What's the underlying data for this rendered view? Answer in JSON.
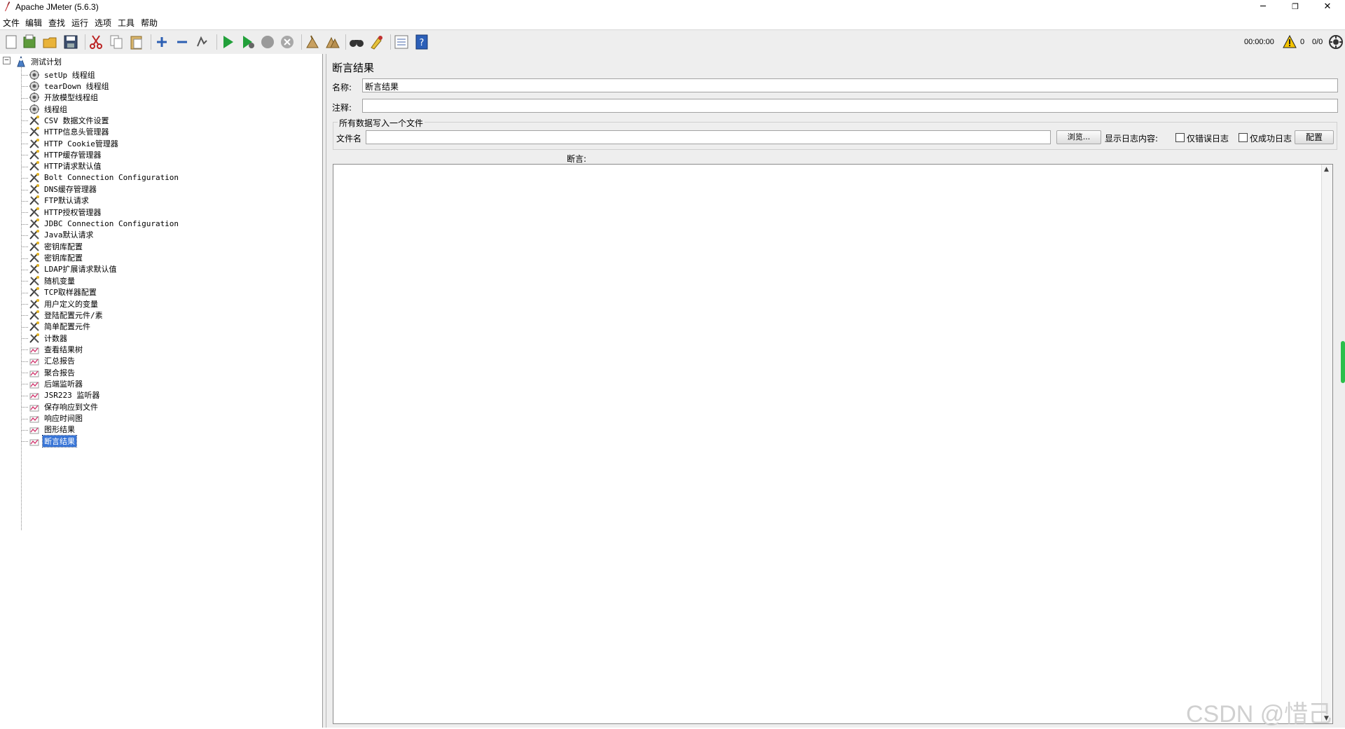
{
  "window": {
    "title": "Apache JMeter (5.6.3)",
    "controls": {
      "minimize": "─",
      "restore": "❐",
      "close": "✕"
    }
  },
  "menu": [
    "文件",
    "编辑",
    "查找",
    "运行",
    "选项",
    "工具",
    "帮助"
  ],
  "toolbar": {
    "icons": [
      "new-icon",
      "templates-icon",
      "open-icon",
      "save-icon",
      "cut-icon",
      "copy-icon",
      "paste-icon",
      "expand-icon",
      "collapse-icon",
      "toggle-icon",
      "start-icon",
      "start-no-pause-icon",
      "stop-icon",
      "shutdown-icon",
      "clear-icon",
      "clear-all-icon",
      "search-icon",
      "reset-search-icon",
      "function-helper-icon",
      "help-icon"
    ],
    "timer": "00:00:00",
    "warning_count": "0",
    "threads": "0/0"
  },
  "tree": {
    "root": "测试计划",
    "items": [
      {
        "label": "setUp 线程组",
        "icon": "thread-group-icon"
      },
      {
        "label": "tearDown 线程组",
        "icon": "thread-group-icon"
      },
      {
        "label": "开放模型线程组",
        "icon": "thread-group-icon"
      },
      {
        "label": "线程组",
        "icon": "thread-group-icon"
      },
      {
        "label": "CSV 数据文件设置",
        "icon": "config-element-icon"
      },
      {
        "label": "HTTP信息头管理器",
        "icon": "config-element-icon"
      },
      {
        "label": "HTTP Cookie管理器",
        "icon": "config-element-icon"
      },
      {
        "label": "HTTP缓存管理器",
        "icon": "config-element-icon"
      },
      {
        "label": "HTTP请求默认值",
        "icon": "config-element-icon"
      },
      {
        "label": "Bolt Connection Configuration",
        "icon": "config-element-icon"
      },
      {
        "label": "DNS缓存管理器",
        "icon": "config-element-icon"
      },
      {
        "label": "FTP默认请求",
        "icon": "config-element-icon"
      },
      {
        "label": "HTTP授权管理器",
        "icon": "config-element-icon"
      },
      {
        "label": "JDBC Connection Configuration",
        "icon": "config-element-icon"
      },
      {
        "label": "Java默认请求",
        "icon": "config-element-icon"
      },
      {
        "label": "密钥库配置",
        "icon": "config-element-icon"
      },
      {
        "label": "密钥库配置",
        "icon": "config-element-icon"
      },
      {
        "label": "LDAP扩展请求默认值",
        "icon": "config-element-icon"
      },
      {
        "label": "随机变量",
        "icon": "config-element-icon"
      },
      {
        "label": "TCP取样器配置",
        "icon": "config-element-icon"
      },
      {
        "label": "用户定义的变量",
        "icon": "config-element-icon"
      },
      {
        "label": "登陆配置元件/素",
        "icon": "config-element-icon"
      },
      {
        "label": "简单配置元件",
        "icon": "config-element-icon"
      },
      {
        "label": "计数器",
        "icon": "config-element-icon"
      },
      {
        "label": "查看结果树",
        "icon": "listener-icon"
      },
      {
        "label": "汇总报告",
        "icon": "listener-icon"
      },
      {
        "label": "聚合报告",
        "icon": "listener-icon"
      },
      {
        "label": "后端监听器",
        "icon": "listener-icon"
      },
      {
        "label": "JSR223 监听器",
        "icon": "listener-icon"
      },
      {
        "label": "保存响应到文件",
        "icon": "listener-icon"
      },
      {
        "label": "响应时间图",
        "icon": "listener-icon"
      },
      {
        "label": "图形结果",
        "icon": "listener-icon"
      },
      {
        "label": "断言结果",
        "icon": "listener-icon",
        "selected": true
      }
    ]
  },
  "panel": {
    "title": "断言结果",
    "name_label": "名称:",
    "name_value": "断言结果",
    "comment_label": "注释:",
    "comment_value": "",
    "file_group_title": "所有数据写入一个文件",
    "filename_label": "文件名",
    "filename_value": "",
    "browse_button": "浏览...",
    "log_display_label": "显示日志内容:",
    "errors_only_label": "仅错误日志",
    "success_only_label": "仅成功日志",
    "configure_button": "配置",
    "assertions_label": "断言:"
  },
  "watermark": "CSDN @惜己"
}
